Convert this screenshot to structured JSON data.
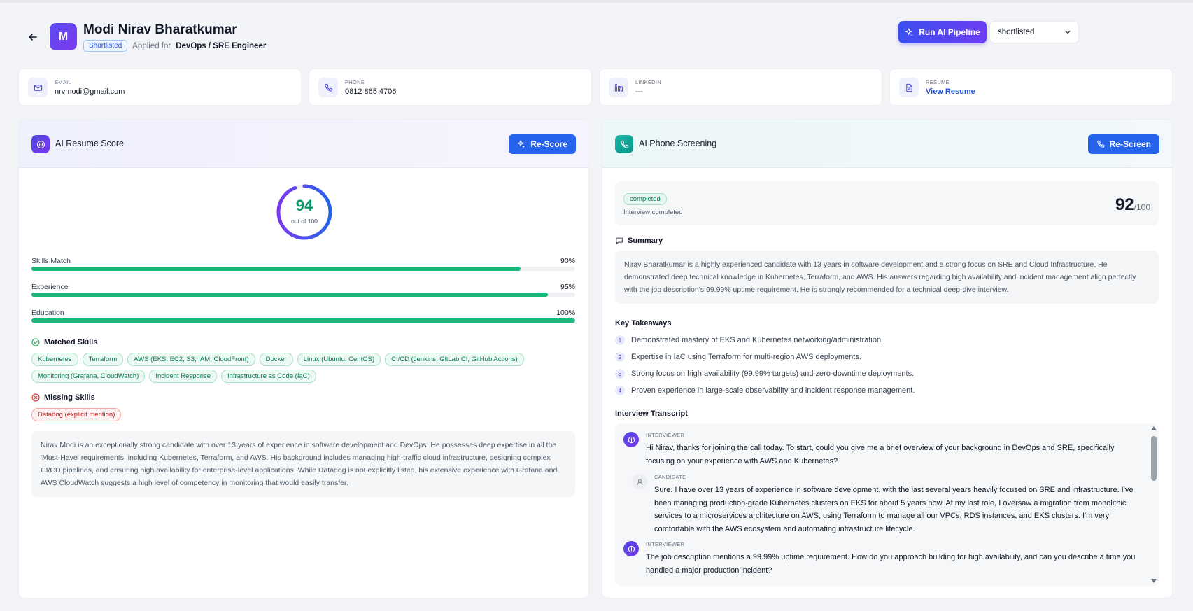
{
  "header": {
    "avatar_initial": "M",
    "name": "Modi Nirav Bharatkumar",
    "status_badge": "Shortlisted",
    "applied_prefix": "Applied for",
    "role": "DevOps / SRE Engineer",
    "run_button": "Run AI Pipeline",
    "status_select": "shortlisted"
  },
  "contacts": [
    {
      "label": "EMAIL",
      "value": "nrvmodi@gmail.com",
      "icon": "mail-icon"
    },
    {
      "label": "PHONE",
      "value": "0812 865 4706",
      "icon": "phone-icon"
    },
    {
      "label": "LINKEDIN",
      "value": "—",
      "icon": "linkedin-icon"
    },
    {
      "label": "RESUME",
      "value": "View Resume",
      "icon": "document-icon"
    }
  ],
  "resume_score": {
    "title": "AI Resume Score",
    "rescore_button": "Re-Score",
    "score": "94",
    "score_value": 94,
    "score_sub": "out of 100",
    "metrics": [
      {
        "label": "Skills Match",
        "value": "90%",
        "fill": 90
      },
      {
        "label": "Experience",
        "value": "95%",
        "fill": 95
      },
      {
        "label": "Education",
        "value": "100%",
        "fill": 100
      }
    ],
    "matched_title": "Matched Skills",
    "matched_skills": [
      "Kubernetes",
      "Terraform",
      "AWS (EKS, EC2, S3, IAM, CloudFront)",
      "Docker",
      "Linux (Ubuntu, CentOS)",
      "CI/CD (Jenkins, GitLab CI, GitHub Actions)",
      "Monitoring (Grafana, CloudWatch)",
      "Incident Response",
      "Infrastructure as Code (IaC)"
    ],
    "missing_title": "Missing Skills",
    "missing_skills": [
      "Datadog (explicit mention)"
    ],
    "summary": "Nirav Modi is an exceptionally strong candidate with over 13 years of experience in software development and DevOps. He possesses deep expertise in all the 'Must-Have' requirements, including Kubernetes, Terraform, and AWS. His background includes managing high-traffic cloud infrastructure, designing complex CI/CD pipelines, and ensuring high availability for enterprise-level applications. While Datadog is not explicitly listed, his extensive experience with Grafana and AWS CloudWatch suggests a high level of competency in monitoring that would easily transfer.",
    "colors": {
      "ring_start": "#7c3aed",
      "ring_end": "#2563eb",
      "bar": "#16b97a",
      "score": "#059669"
    }
  },
  "screening": {
    "title": "AI Phone Screening",
    "rescreen_button": "Re-Screen",
    "status": "completed",
    "status_text": "Interview completed",
    "score": "92",
    "score_suffix": "/100",
    "summary_title": "Summary",
    "summary": "Nirav Bharatkumar is a highly experienced candidate with 13 years in software development and a strong focus on SRE and Cloud Infrastructure. He demonstrated deep technical knowledge in Kubernetes, Terraform, and AWS. His answers regarding high availability and incident management align perfectly with the job description's 99.99% uptime requirement. He is strongly recommended for a technical deep-dive interview.",
    "takeaways_title": "Key Takeaways",
    "takeaways": [
      {
        "n": "1",
        "text": "Demonstrated mastery of EKS and Kubernetes networking/administration."
      },
      {
        "n": "2",
        "text": "Expertise in IaC using Terraform for multi-region AWS deployments."
      },
      {
        "n": "3",
        "text": "Strong focus on high availability (99.99% targets) and zero-downtime deployments."
      },
      {
        "n": "4",
        "text": "Proven experience in large-scale observability and incident response management."
      }
    ],
    "transcript_title": "Interview Transcript",
    "transcript": [
      {
        "role": "INTERVIEWER",
        "text": "Hi Nirav, thanks for joining the call today. To start, could you give me a brief overview of your background in DevOps and SRE, specifically focusing on your experience with AWS and Kubernetes?"
      },
      {
        "role": "CANDIDATE",
        "text": "Sure. I have over 13 years of experience in software development, with the last several years heavily focused on SRE and infrastructure. I've been managing production-grade Kubernetes clusters on EKS for about 5 years now. At my last role, I oversaw a migration from monolithic services to a microservices architecture on AWS, using Terraform to manage all our VPCs, RDS instances, and EKS clusters. I'm very comfortable with the AWS ecosystem and automating infrastructure lifecycle."
      },
      {
        "role": "INTERVIEWER",
        "text": "The job description mentions a 99.99% uptime requirement. How do you approach building for high availability, and can you describe a time you handled a major production incident?"
      }
    ]
  }
}
